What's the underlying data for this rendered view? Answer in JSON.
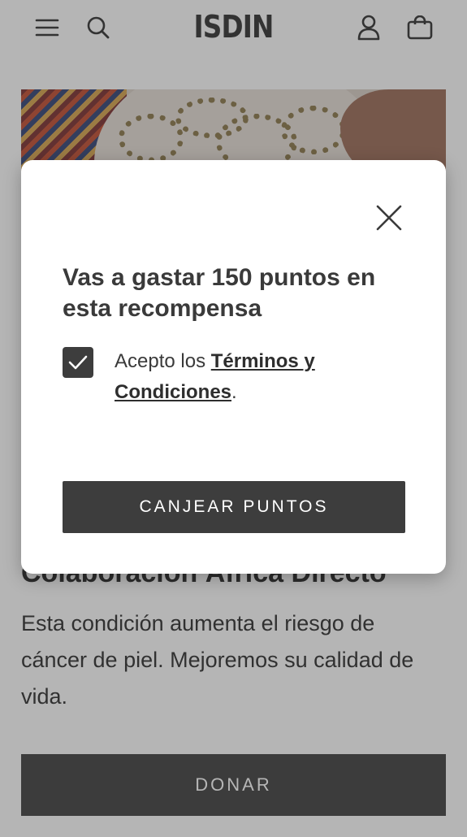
{
  "header": {
    "logo": "ISDIN",
    "icons": [
      "menu-icon",
      "search-icon",
      "user-icon",
      "bag-icon"
    ]
  },
  "article": {
    "title": "Colaboración África Directo",
    "description": "Esta condición aumenta el riesgo de cáncer de piel. Mejoremos su calidad de vida.",
    "donate_label": "DONAR"
  },
  "modal": {
    "title": "Vas a gastar 150 puntos en esta recompensa",
    "consent_prefix": "Acepto los ",
    "terms_link": "Términos y Condiciones",
    "consent_suffix": ".",
    "checkbox_checked": true,
    "redeem_label": "CANJEAR PUNTOS"
  },
  "colors": {
    "dark": "#3d3d3d",
    "overlay": "rgba(60,60,60,0.38)"
  }
}
